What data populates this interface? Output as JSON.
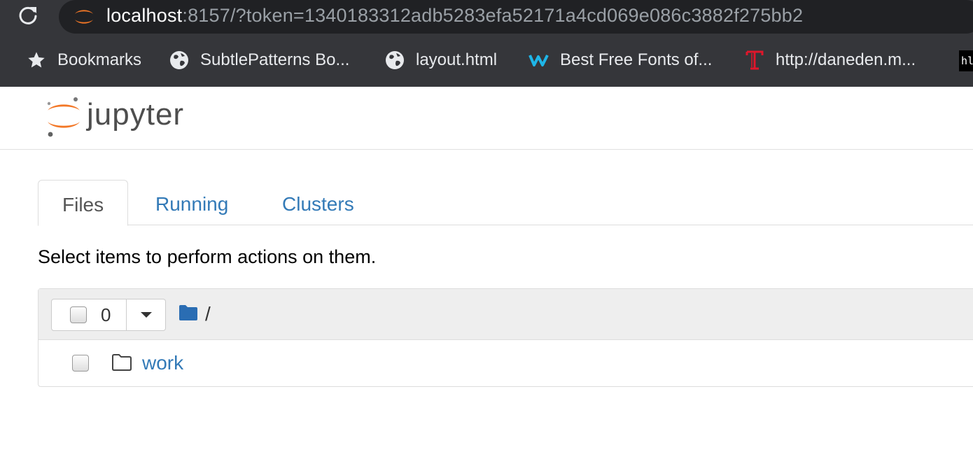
{
  "browser": {
    "url_host": "localhost",
    "url_rest": ":8157/?token=1340183312adb5283efa52171a4cd069e086c3882f275bb2",
    "bookmarks": [
      {
        "label": "Bookmarks",
        "icon": "star-icon"
      },
      {
        "label": "SubtlePatterns Bo...",
        "icon": "globe-icon"
      },
      {
        "label": "layout.html",
        "icon": "globe-icon"
      },
      {
        "label": "Best Free Fonts of...",
        "icon": "w-logo-icon"
      },
      {
        "label": "http://daneden.m...",
        "icon": "t-logo-icon"
      }
    ],
    "overflow_bookmark_text": "hl"
  },
  "jupyter": {
    "logo_text": "jupyter",
    "tabs": [
      {
        "label": "Files",
        "active": true
      },
      {
        "label": "Running",
        "active": false
      },
      {
        "label": "Clusters",
        "active": false
      }
    ],
    "hint": "Select items to perform actions on them.",
    "selected_count": "0",
    "breadcrumb_separator": "/",
    "items": [
      {
        "name": "work",
        "type": "folder"
      }
    ]
  },
  "colors": {
    "chrome_bg": "#35363a",
    "omnibox_bg": "#202124",
    "link_blue": "#337ab7",
    "jupyter_orange": "#f37726",
    "folder_blue": "#2a6db3"
  }
}
